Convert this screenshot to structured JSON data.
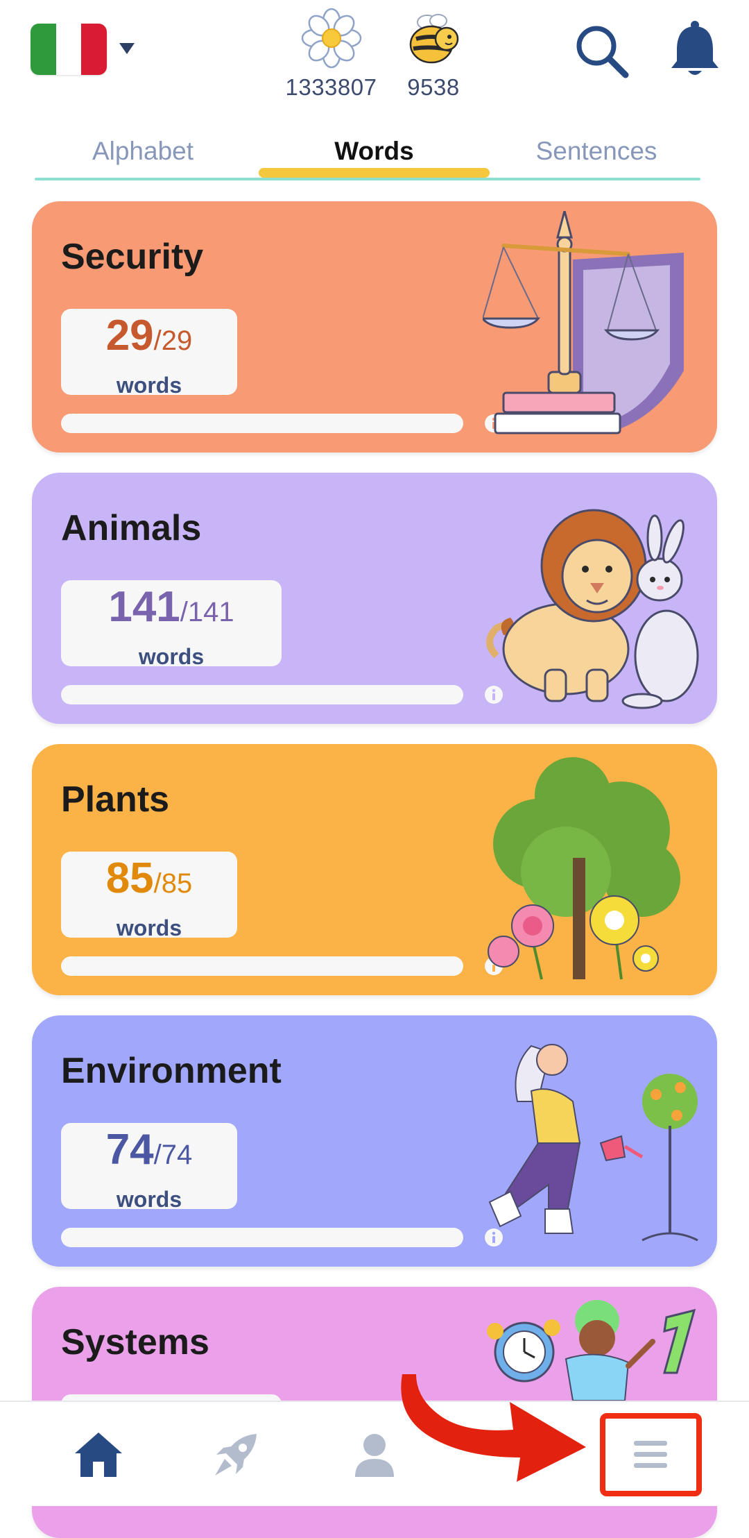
{
  "header": {
    "flag_colors": [
      "#2f9a3c",
      "#ffffff",
      "#d91c34"
    ],
    "flowers_count": "1333807",
    "bees_count": "9538"
  },
  "tabs": [
    {
      "label": "Alphabet",
      "active": false
    },
    {
      "label": "Words",
      "active": true
    },
    {
      "label": "Sentences",
      "active": false
    }
  ],
  "cards": [
    {
      "title": "Security",
      "learned": "29",
      "total": "/29",
      "unit": "words",
      "color": "#f89a74",
      "accent": "#c65a2e",
      "progress": 1.0
    },
    {
      "title": "Animals",
      "learned": "141",
      "total": "/141",
      "unit": "words",
      "color": "#c7b5f7",
      "accent": "#7a63ad",
      "progress": 1.0
    },
    {
      "title": "Plants",
      "learned": "85",
      "total": "/85",
      "unit": "words",
      "color": "#fbb246",
      "accent": "#e0890b",
      "progress": 1.0
    },
    {
      "title": "Environment",
      "learned": "74",
      "total": "/74",
      "unit": "words",
      "color": "#a1a8fb",
      "accent": "#4c57a3",
      "progress": 1.0
    },
    {
      "title": "Systems",
      "color": "#eba1ea"
    }
  ],
  "bottom_nav": [
    "home-icon",
    "rocket-icon",
    "profile-icon",
    "menu-icon"
  ]
}
